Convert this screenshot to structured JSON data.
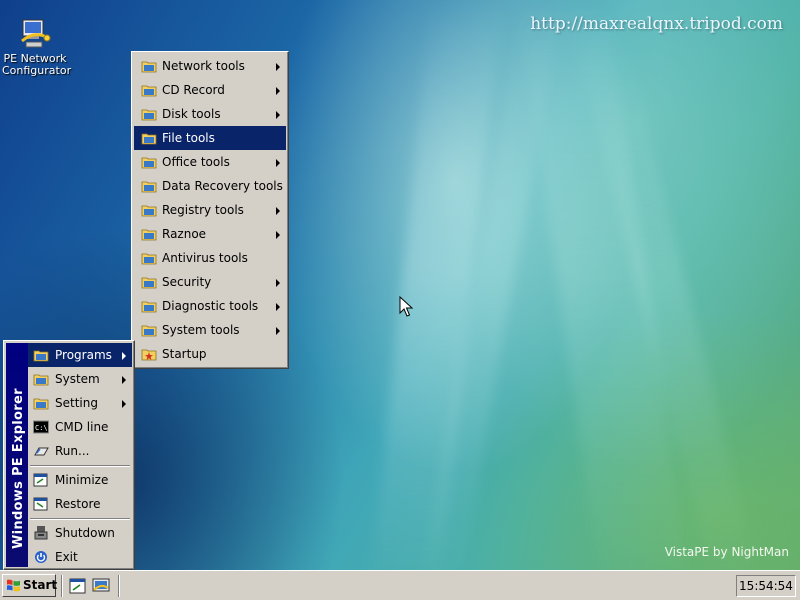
{
  "desktop": {
    "icons": [
      {
        "label": "PE Network\nConfigurator",
        "icon": "network-configurator-icon"
      }
    ],
    "url_text": "http://maxrealqnx.tripod.com",
    "watermark": "VistaPE by NightMan"
  },
  "programs_menu": {
    "items": [
      {
        "label": "Network tools",
        "submenu": true
      },
      {
        "label": "CD Record",
        "submenu": true
      },
      {
        "label": "Disk tools",
        "submenu": true
      },
      {
        "label": "File tools",
        "submenu": false,
        "selected": true
      },
      {
        "label": "Office tools",
        "submenu": true
      },
      {
        "label": "Data Recovery tools",
        "submenu": false
      },
      {
        "label": "Registry tools",
        "submenu": true
      },
      {
        "label": "Raznoe",
        "submenu": true
      },
      {
        "label": "Antivirus tools",
        "submenu": false
      },
      {
        "label": "Security",
        "submenu": true
      },
      {
        "label": "Diagnostic tools",
        "submenu": true
      },
      {
        "label": "System tools",
        "submenu": true
      },
      {
        "label": "Startup",
        "submenu": false
      }
    ]
  },
  "start_menu": {
    "banner": "Windows PE  Explorer",
    "items": [
      {
        "label": "Programs",
        "icon": "folder-icon",
        "submenu": true,
        "selected": true
      },
      {
        "label": "System",
        "icon": "folder-icon",
        "submenu": true
      },
      {
        "label": "Setting",
        "icon": "folder-icon",
        "submenu": true
      },
      {
        "label": "CMD line",
        "icon": "cmd-icon"
      },
      {
        "label": "Run...",
        "icon": "run-icon"
      },
      {
        "label": "Minimize",
        "icon": "minimize-icon"
      },
      {
        "label": "Restore",
        "icon": "restore-icon"
      },
      {
        "label": "Shutdown",
        "icon": "shutdown-icon"
      },
      {
        "label": "Exit",
        "icon": "exit-icon"
      }
    ]
  },
  "taskbar": {
    "start_label": "Start",
    "clock": "15:54:54"
  },
  "colors": {
    "selection": "#0a246a",
    "menu_face": "#d4d0c8",
    "banner": "#000080"
  }
}
